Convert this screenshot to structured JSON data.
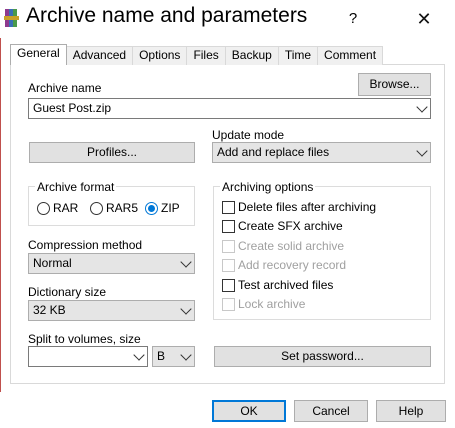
{
  "window": {
    "title": "Archive name and parameters",
    "help_glyph": "?",
    "close_glyph": "✕"
  },
  "tabs": [
    "General",
    "Advanced",
    "Options",
    "Files",
    "Backup",
    "Time",
    "Comment"
  ],
  "general": {
    "archive_name_label": "Archive name",
    "browse_label": "Browse...",
    "archive_name_value": "Guest Post.zip",
    "update_mode_label": "Update mode",
    "update_mode_value": "Add and replace files",
    "profiles_label": "Profiles...",
    "archive_format": {
      "title": "Archive format",
      "options": [
        "RAR",
        "RAR5",
        "ZIP"
      ],
      "selected": "ZIP"
    },
    "compression_label": "Compression method",
    "compression_value": "Normal",
    "dictionary_label": "Dictionary size",
    "dictionary_value": "32 KB",
    "split_label": "Split to volumes, size",
    "split_value": "",
    "split_unit": "B",
    "archiving_options": {
      "title": "Archiving options",
      "items": [
        {
          "label": "Delete files after archiving",
          "checked": false,
          "enabled": true
        },
        {
          "label": "Create SFX archive",
          "checked": false,
          "enabled": true
        },
        {
          "label": "Create solid archive",
          "checked": false,
          "enabled": false
        },
        {
          "label": "Add recovery record",
          "checked": false,
          "enabled": false
        },
        {
          "label": "Test archived files",
          "checked": false,
          "enabled": true
        },
        {
          "label": "Lock archive",
          "checked": false,
          "enabled": false
        }
      ]
    },
    "set_password_label": "Set password..."
  },
  "footer": {
    "ok_label": "OK",
    "cancel_label": "Cancel",
    "help_label": "Help"
  },
  "colors": {
    "accent": "#0078d7",
    "frame": "#c0504d",
    "button_face": "#e1e1e1"
  }
}
